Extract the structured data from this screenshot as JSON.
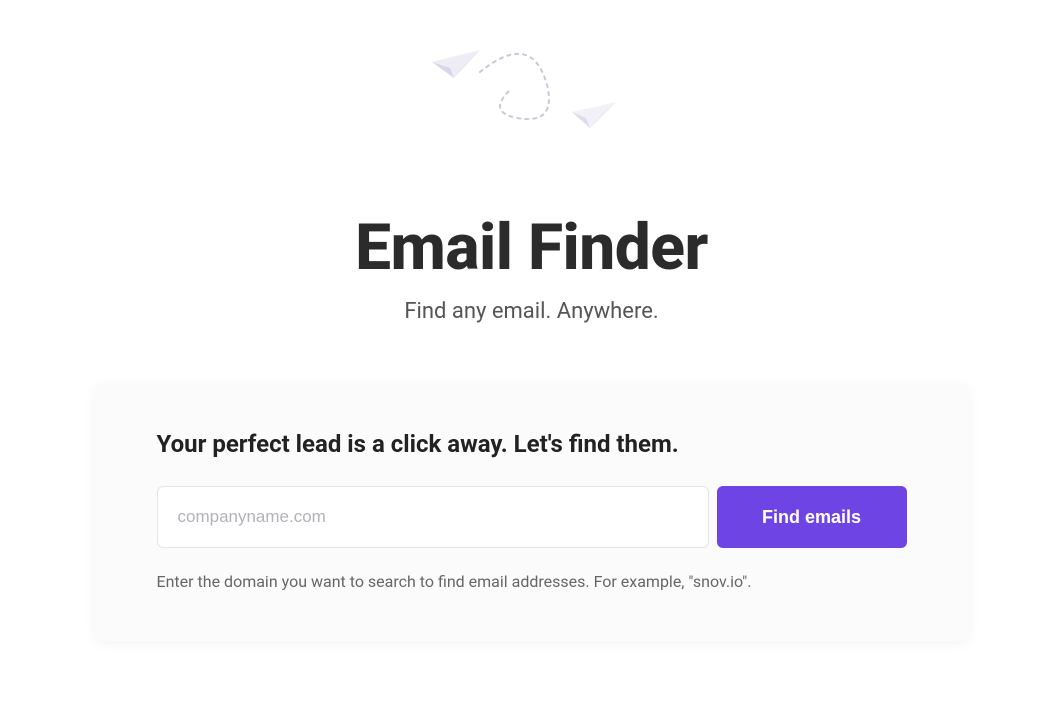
{
  "header": {
    "title": "Email Finder",
    "subtitle": "Find any email. Anywhere."
  },
  "card": {
    "title": "Your perfect lead is a click away. Let's find them.",
    "input_placeholder": "companyname.com",
    "button_label": "Find emails",
    "helper_text": "Enter the domain you want to search to find email addresses. For example, \"snov.io\"."
  },
  "colors": {
    "accent": "#6e44e5",
    "text_dark": "#2b2b2b",
    "text_muted": "#666"
  }
}
